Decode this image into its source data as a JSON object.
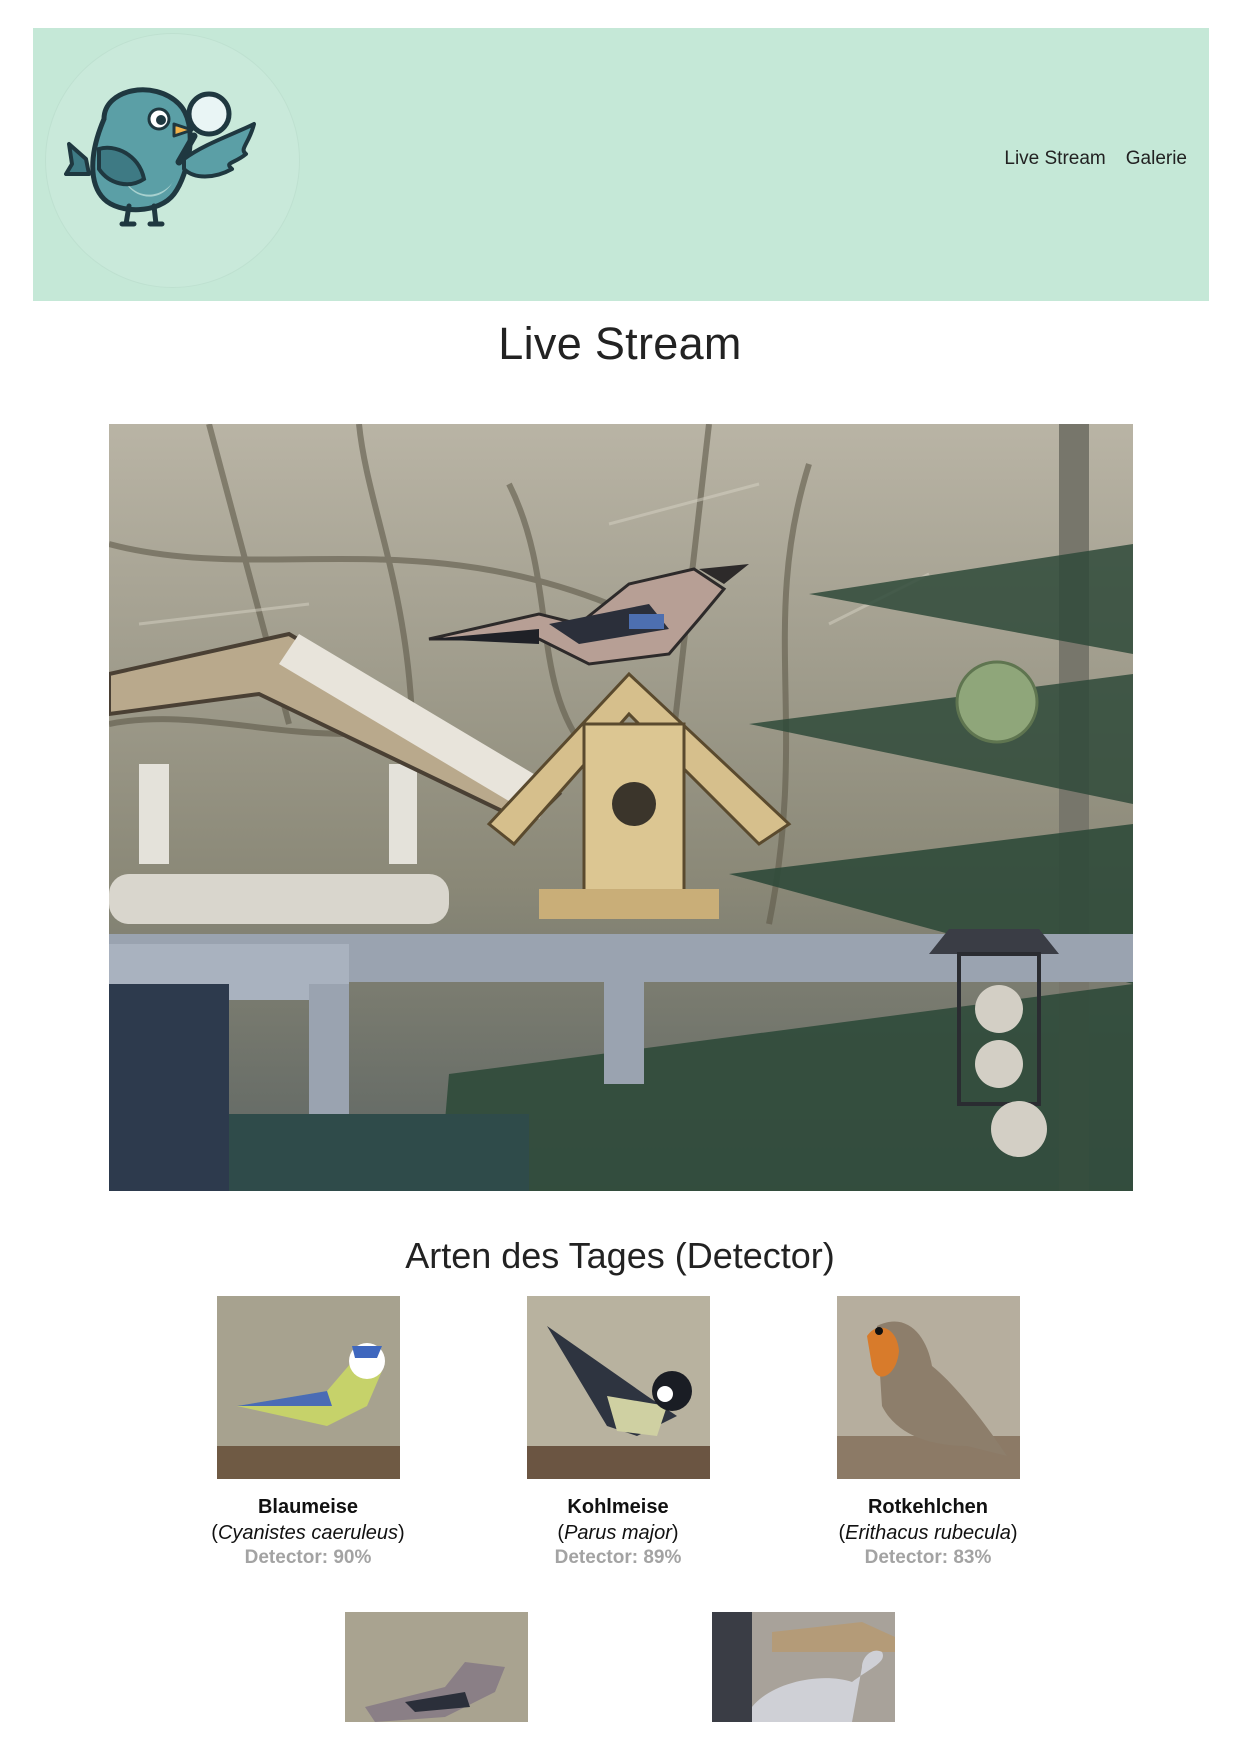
{
  "header": {
    "logo_alt": "bird-with-magnifier-logo",
    "nav": [
      {
        "label": "Live Stream"
      },
      {
        "label": "Galerie"
      }
    ],
    "background": "#c5e8d7"
  },
  "main": {
    "title": "Live Stream",
    "stream_alt": "live-camera-feed",
    "species_section_title": "Arten des Tages (Detector)",
    "species": [
      {
        "common": "Blaumeise",
        "scientific": "Cyanistes caeruleus",
        "detector": "Detector: 90%"
      },
      {
        "common": "Kohlmeise",
        "scientific": "Parus major",
        "detector": "Detector: 89%"
      },
      {
        "common": "Rotkehlchen",
        "scientific": "Erithacus rubecula",
        "detector": "Detector: 83%"
      }
    ]
  }
}
